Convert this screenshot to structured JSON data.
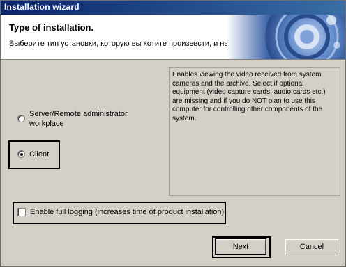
{
  "window": {
    "title": "Installation wizard"
  },
  "header": {
    "title": "Type of installation.",
    "subtitle": "Выберите тип установки, которую вы хотите произвести, и нажмите «Далее»."
  },
  "description": "Enables viewing the video received from system cameras and the archive. Select if optional equipment (video capture cards, audio cards etc.) are missing and if you do NOT plan to use this computer for controlling other components of the system.",
  "options": [
    {
      "label_line1": "Server/Remote administrator",
      "label_line2": "workplace",
      "selected": false
    },
    {
      "label": "Client",
      "selected": true
    }
  ],
  "logging": {
    "label": "Enable full logging (increases time of product installation)",
    "checked": false
  },
  "buttons": {
    "next": "Next",
    "cancel": "Cancel"
  },
  "colors": {
    "titlebar": "#0a246a",
    "dialog": "#d4d0c8",
    "header_bg": "#ffffff"
  },
  "icons": {
    "header_graphic": "blue-sphere-graphic"
  }
}
